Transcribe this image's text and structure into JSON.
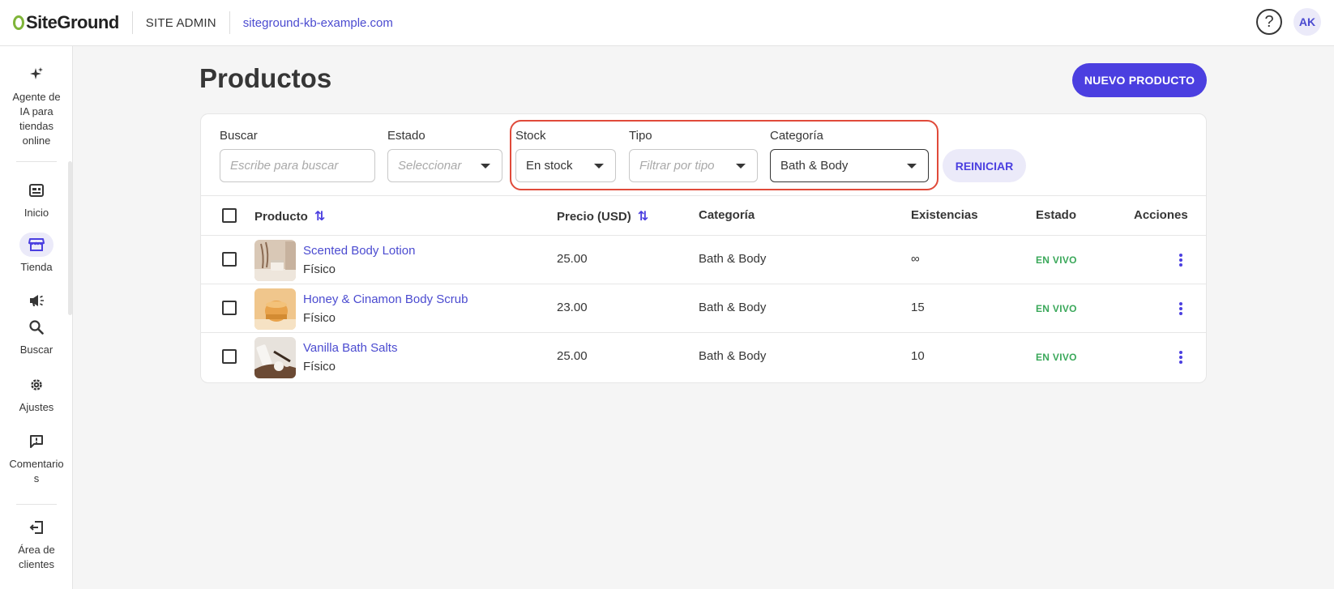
{
  "topbar": {
    "logo_text": "SiteGround",
    "site_admin": "SITE ADMIN",
    "site_domain": "siteground-kb-example.com",
    "help_icon": "?",
    "avatar_initials": "AK"
  },
  "sidebar": {
    "items": [
      {
        "label": "Agente de IA para tiendas online",
        "icon": "sparkle-icon"
      },
      {
        "label": "Inicio",
        "icon": "dashboard-icon"
      },
      {
        "label": "Tienda",
        "icon": "store-icon",
        "active": true
      },
      {
        "label": "",
        "icon": "megaphone-icon"
      },
      {
        "label": "Buscar",
        "icon": "search-icon"
      },
      {
        "label": "Ajustes",
        "icon": "gear-icon"
      },
      {
        "label": "Comentarios",
        "icon": "comment-alert-icon"
      },
      {
        "label": "Área de clientes",
        "icon": "exit-icon"
      }
    ]
  },
  "page": {
    "title": "Productos",
    "new_button": "NUEVO PRODUCTO"
  },
  "filters": {
    "search": {
      "label": "Buscar",
      "placeholder": "Escribe para buscar"
    },
    "estado": {
      "label": "Estado",
      "placeholder": "Seleccionar"
    },
    "stock": {
      "label": "Stock",
      "value": "En stock"
    },
    "tipo": {
      "label": "Tipo",
      "placeholder": "Filtrar por tipo"
    },
    "categoria": {
      "label": "Categoría",
      "value": "Bath & Body"
    },
    "reset_button": "REINICIAR"
  },
  "table": {
    "headers": {
      "producto": "Producto",
      "precio": "Precio (USD)",
      "categoria": "Categoría",
      "existencias": "Existencias",
      "estado": "Estado",
      "acciones": "Acciones"
    },
    "rows": [
      {
        "name": "Scented Body Lotion",
        "type": "Físico",
        "price": "25.00",
        "category": "Bath & Body",
        "stock": "∞",
        "status": "EN VIVO"
      },
      {
        "name": "Honey & Cinamon Body Scrub",
        "type": "Físico",
        "price": "23.00",
        "category": "Bath & Body",
        "stock": "15",
        "status": "EN VIVO"
      },
      {
        "name": "Vanilla Bath Salts",
        "type": "Físico",
        "price": "25.00",
        "category": "Bath & Body",
        "stock": "10",
        "status": "EN VIVO"
      }
    ]
  },
  "colors": {
    "accent": "#4b3fe0",
    "link": "#4b4bd0",
    "status_live": "#3aa85a",
    "highlight": "#e04a3a"
  }
}
